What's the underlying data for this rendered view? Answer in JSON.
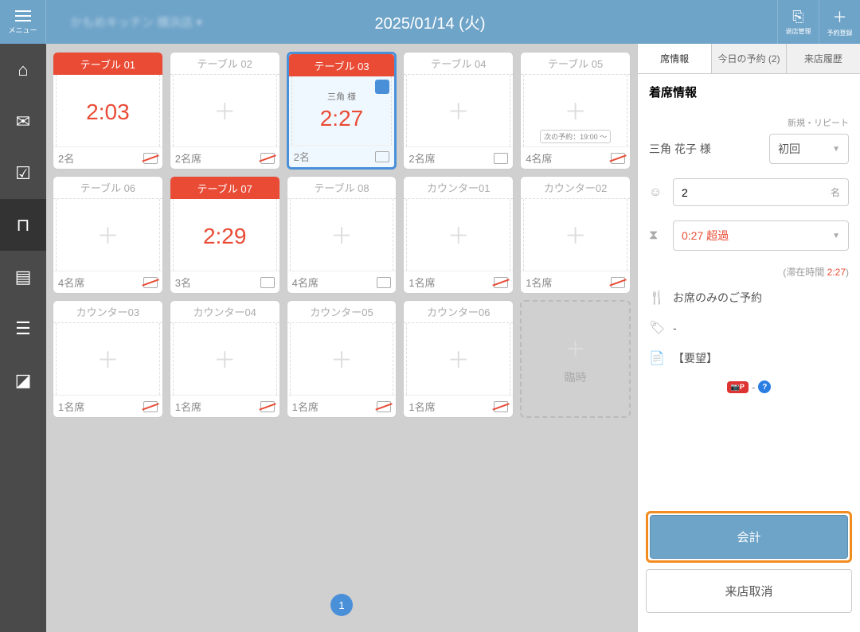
{
  "header": {
    "menu_label": "メニュー",
    "store_name": "かもめキッチン 横浜店",
    "date_title": "2025/01/14 (火)",
    "action1_label": "退店管理",
    "action2_label": "予約登録"
  },
  "tables": [
    {
      "name": "テーブル 01",
      "occupied": true,
      "timer": "2:03",
      "foot": "2名",
      "smoke": true
    },
    {
      "name": "テーブル 02",
      "occupied": false,
      "foot": "2名席",
      "smoke": true
    },
    {
      "name": "テーブル 03",
      "occupied": true,
      "selected": true,
      "guest": "三角 様",
      "timer": "2:27",
      "foot": "2名",
      "smoke": false,
      "corner": true
    },
    {
      "name": "テーブル 04",
      "occupied": false,
      "foot": "2名席",
      "smoke": false
    },
    {
      "name": "テーブル 05",
      "occupied": false,
      "foot": "4名席",
      "smoke": true,
      "next": "次の予約：19:00 〜"
    },
    {
      "name": "テーブル 06",
      "occupied": false,
      "foot": "4名席",
      "smoke": true
    },
    {
      "name": "テーブル 07",
      "occupied": true,
      "timer": "2:29",
      "foot": "3名",
      "smoke": false
    },
    {
      "name": "テーブル 08",
      "occupied": false,
      "foot": "4名席",
      "smoke": false
    },
    {
      "name": "カウンター01",
      "occupied": false,
      "foot": "1名席",
      "smoke": true
    },
    {
      "name": "カウンター02",
      "occupied": false,
      "foot": "1名席",
      "smoke": true
    },
    {
      "name": "カウンター03",
      "occupied": false,
      "foot": "1名席",
      "smoke": true
    },
    {
      "name": "カウンター04",
      "occupied": false,
      "foot": "1名席",
      "smoke": true
    },
    {
      "name": "カウンター05",
      "occupied": false,
      "foot": "1名席",
      "smoke": true
    },
    {
      "name": "カウンター06",
      "occupied": false,
      "foot": "1名席",
      "smoke": true
    }
  ],
  "temp_label": "臨時",
  "page_num": "1",
  "panel": {
    "tabs": {
      "t1": "席情報",
      "t2": "今日の予約 (2)",
      "t3": "来店履歴"
    },
    "title": "着席情報",
    "repeat_label": "新規・リピート",
    "guest_name": "三角 花子 様",
    "visit_type": "初回",
    "party_size": "2",
    "party_unit": "名",
    "overtime_value": "0:27",
    "overtime_label": "超過",
    "stay_prefix": "(滞在時間 ",
    "stay_value": "2:27",
    "stay_suffix": ")",
    "course": "お席のみのご予約",
    "tag": "-",
    "request": "【要望】",
    "point_badge": "P",
    "badge_sep": "-",
    "help_badge": "?",
    "btn_checkout": "会計",
    "btn_cancel": "来店取消"
  }
}
